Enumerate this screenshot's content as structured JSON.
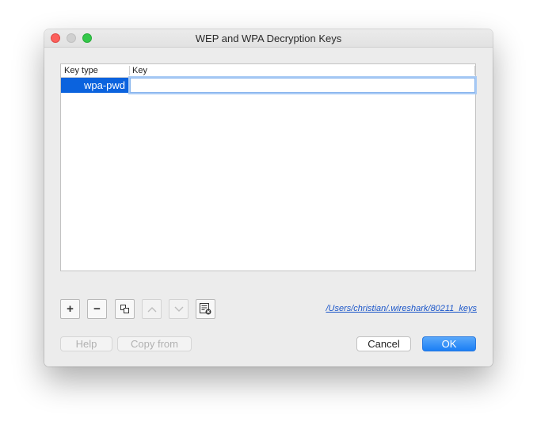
{
  "window": {
    "title": "WEP and WPA Decryption Keys"
  },
  "table": {
    "columns": [
      "Key type",
      "Key"
    ],
    "rows": [
      {
        "key_type": "wpa-pwd",
        "key": ""
      }
    ]
  },
  "toolbar": {
    "add_label": "+",
    "remove_label": "−",
    "up_label": "⌃",
    "down_label": "⌄",
    "path_link": "/Users/christian/.wireshark/80211_keys"
  },
  "buttons": {
    "help": "Help",
    "copy_from": "Copy from",
    "cancel": "Cancel",
    "ok": "OK"
  },
  "colors": {
    "selection": "#0b63de",
    "link": "#1b56c9",
    "default_button": "#1a7ef5"
  }
}
